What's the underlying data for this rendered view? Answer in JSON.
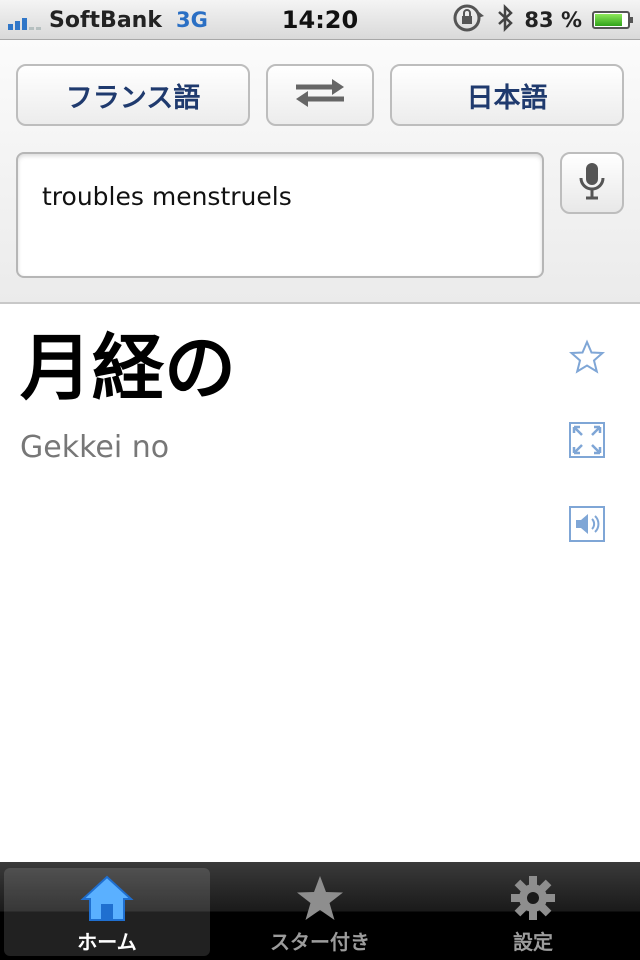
{
  "status_bar": {
    "carrier": "SoftBank",
    "network": "3G",
    "time": "14:20",
    "battery_percent": "83 %",
    "battery_level": 0.83
  },
  "language_bar": {
    "source_language": "フランス語",
    "target_language": "日本語",
    "swap_icon": "swap-arrows-icon"
  },
  "input": {
    "text": "troubles menstruels",
    "mic_icon": "microphone-icon"
  },
  "result": {
    "translation": "月経の",
    "transliteration": "Gekkei no",
    "icons": [
      "star-outline-icon",
      "fullscreen-icon",
      "speaker-icon"
    ]
  },
  "tabbar": {
    "tabs": [
      {
        "label": "ホーム",
        "icon": "home-icon",
        "active": true
      },
      {
        "label": "スター付き",
        "icon": "star-icon",
        "active": false
      },
      {
        "label": "設定",
        "icon": "gear-icon",
        "active": false
      }
    ]
  },
  "colors": {
    "accent_blue": "#3177c8",
    "language_text": "#1f3a6e",
    "icon_blue": "#7fa6d6"
  }
}
